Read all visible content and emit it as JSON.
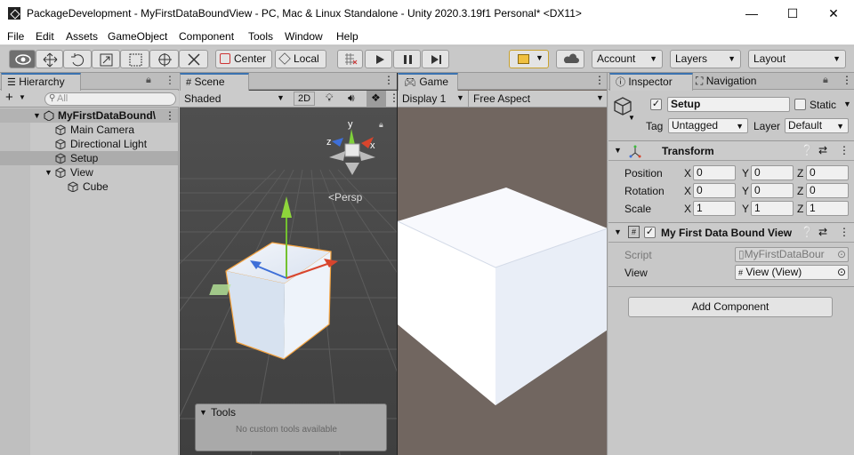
{
  "window": {
    "title": "PackageDevelopment - MyFirstDataBoundView - PC, Mac & Linux Standalone - Unity 2020.3.19f1 Personal* <DX11>",
    "minimize": "—",
    "maximize": "☐",
    "close": "✕"
  },
  "menu": [
    "File",
    "Edit",
    "Assets",
    "GameObject",
    "Component",
    "Tools",
    "Window",
    "Help"
  ],
  "toolbar": {
    "center_label": "Center",
    "local_label": "Local",
    "account_label": "Account",
    "layers_label": "Layers",
    "layout_label": "Layout",
    "accent_color": "#f0c040"
  },
  "hierarchy": {
    "tab": "Hierarchy",
    "add": "+",
    "search_placeholder": "All",
    "root": "MyFirstDataBound\\",
    "items": [
      {
        "label": "Main Camera",
        "level": 1
      },
      {
        "label": "Directional Light",
        "level": 1
      },
      {
        "label": "Setup",
        "level": 1,
        "selected": true
      },
      {
        "label": "View",
        "level": 1,
        "expanded": true
      },
      {
        "label": "Cube",
        "level": 2
      }
    ]
  },
  "scene": {
    "tab": "Scene",
    "shading": "Shaded",
    "mode_2d": "2D",
    "gizmo_y": "y",
    "gizmo_x": "x",
    "gizmo_z": "z",
    "persp": "<Persp",
    "tools_title": "Tools",
    "tools_empty": "No custom tools available"
  },
  "game": {
    "tab": "Game",
    "display": "Display 1",
    "aspect": "Free Aspect",
    "background_color": "#716660"
  },
  "inspector": {
    "tab": "Inspector",
    "nav_tab": "Navigation",
    "object_name": "Setup",
    "static_label": "Static",
    "tag_label": "Tag",
    "tag_value": "Untagged",
    "layer_label": "Layer",
    "layer_value": "Default",
    "transform": {
      "title": "Transform",
      "position_label": "Position",
      "rotation_label": "Rotation",
      "scale_label": "Scale",
      "axis_x": "X",
      "axis_y": "Y",
      "axis_z": "Z",
      "position": [
        "0",
        "0",
        "0"
      ],
      "rotation": [
        "0",
        "0",
        "0"
      ],
      "scale": [
        "1",
        "1",
        "1"
      ]
    },
    "component": {
      "title": "My First Data Bound View",
      "script_label": "Script",
      "script_value": "MyFirstDataBour",
      "view_label": "View",
      "view_value": "View (View)"
    },
    "add_component": "Add Component"
  }
}
